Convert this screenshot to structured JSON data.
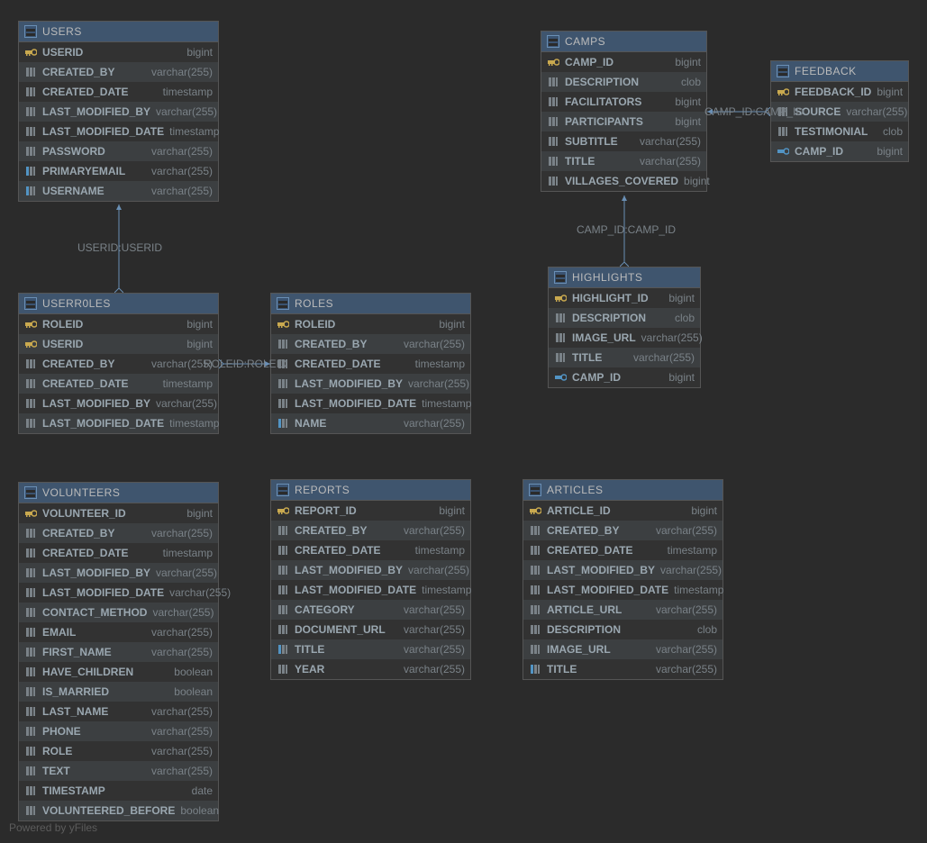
{
  "footer": "Powered by yFiles",
  "relations": {
    "users_userroles": "USERID:USERID",
    "roles_userroles": "ROLEID:ROLEID",
    "camps_highlights": "CAMP_ID:CAMP_ID",
    "camps_feedback": "CAMP_ID:CAMP_ID"
  },
  "tables": {
    "users": {
      "name": "USERS",
      "cols": [
        {
          "k": "pk",
          "n": "USERID",
          "t": "bigint"
        },
        {
          "k": "col",
          "n": "CREATED_BY",
          "t": "varchar(255)"
        },
        {
          "k": "col",
          "n": "CREATED_DATE",
          "t": "timestamp"
        },
        {
          "k": "col",
          "n": "LAST_MODIFIED_BY",
          "t": "varchar(255)"
        },
        {
          "k": "col",
          "n": "LAST_MODIFIED_DATE",
          "t": "timestamp"
        },
        {
          "k": "col",
          "n": "PASSWORD",
          "t": "varchar(255)"
        },
        {
          "k": "idx",
          "n": "PRIMARYEMAIL",
          "t": "varchar(255)"
        },
        {
          "k": "idx",
          "n": "USERNAME",
          "t": "varchar(255)"
        }
      ]
    },
    "userroles": {
      "name": "USERR0LES",
      "cols": [
        {
          "k": "pk",
          "n": "ROLEID",
          "t": "bigint"
        },
        {
          "k": "pk",
          "n": "USERID",
          "t": "bigint"
        },
        {
          "k": "col",
          "n": "CREATED_BY",
          "t": "varchar(255)"
        },
        {
          "k": "col",
          "n": "CREATED_DATE",
          "t": "timestamp"
        },
        {
          "k": "col",
          "n": "LAST_MODIFIED_BY",
          "t": "varchar(255)"
        },
        {
          "k": "col",
          "n": "LAST_MODIFIED_DATE",
          "t": "timestamp"
        }
      ]
    },
    "roles": {
      "name": "ROLES",
      "cols": [
        {
          "k": "pk",
          "n": "ROLEID",
          "t": "bigint"
        },
        {
          "k": "col",
          "n": "CREATED_BY",
          "t": "varchar(255)"
        },
        {
          "k": "col",
          "n": "CREATED_DATE",
          "t": "timestamp"
        },
        {
          "k": "col",
          "n": "LAST_MODIFIED_BY",
          "t": "varchar(255)"
        },
        {
          "k": "col",
          "n": "LAST_MODIFIED_DATE",
          "t": "timestamp"
        },
        {
          "k": "idx",
          "n": "NAME",
          "t": "varchar(255)"
        }
      ]
    },
    "camps": {
      "name": "CAMPS",
      "cols": [
        {
          "k": "pk",
          "n": "CAMP_ID",
          "t": "bigint"
        },
        {
          "k": "col",
          "n": "DESCRIPTION",
          "t": "clob"
        },
        {
          "k": "col",
          "n": "FACILITATORS",
          "t": "bigint"
        },
        {
          "k": "col",
          "n": "PARTICIPANTS",
          "t": "bigint"
        },
        {
          "k": "col",
          "n": "SUBTITLE",
          "t": "varchar(255)"
        },
        {
          "k": "col",
          "n": "TITLE",
          "t": "varchar(255)"
        },
        {
          "k": "col",
          "n": "VILLAGES_COVERED",
          "t": "bigint"
        }
      ]
    },
    "feedback": {
      "name": "FEEDBACK",
      "cols": [
        {
          "k": "pk",
          "n": "FEEDBACK_ID",
          "t": "bigint"
        },
        {
          "k": "col",
          "n": "SOURCE",
          "t": "varchar(255)"
        },
        {
          "k": "col",
          "n": "TESTIMONIAL",
          "t": "clob"
        },
        {
          "k": "fk",
          "n": "CAMP_ID",
          "t": "bigint"
        }
      ]
    },
    "highlights": {
      "name": "HIGHLIGHTS",
      "cols": [
        {
          "k": "pk",
          "n": "HIGHLIGHT_ID",
          "t": "bigint"
        },
        {
          "k": "col",
          "n": "DESCRIPTION",
          "t": "clob"
        },
        {
          "k": "col",
          "n": "IMAGE_URL",
          "t": "varchar(255)"
        },
        {
          "k": "col",
          "n": "TITLE",
          "t": "varchar(255)"
        },
        {
          "k": "fk",
          "n": "CAMP_ID",
          "t": "bigint"
        }
      ]
    },
    "volunteers": {
      "name": "VOLUNTEERS",
      "cols": [
        {
          "k": "pk",
          "n": "VOLUNTEER_ID",
          "t": "bigint"
        },
        {
          "k": "col",
          "n": "CREATED_BY",
          "t": "varchar(255)"
        },
        {
          "k": "col",
          "n": "CREATED_DATE",
          "t": "timestamp"
        },
        {
          "k": "col",
          "n": "LAST_MODIFIED_BY",
          "t": "varchar(255)"
        },
        {
          "k": "col",
          "n": "LAST_MODIFIED_DATE",
          "t": "varchar(255)"
        },
        {
          "k": "col",
          "n": "CONTACT_METHOD",
          "t": "varchar(255)"
        },
        {
          "k": "col",
          "n": "EMAIL",
          "t": "varchar(255)"
        },
        {
          "k": "col",
          "n": "FIRST_NAME",
          "t": "varchar(255)"
        },
        {
          "k": "col",
          "n": "HAVE_CHILDREN",
          "t": "boolean"
        },
        {
          "k": "col",
          "n": "IS_MARRIED",
          "t": "boolean"
        },
        {
          "k": "col",
          "n": "LAST_NAME",
          "t": "varchar(255)"
        },
        {
          "k": "col",
          "n": "PHONE",
          "t": "varchar(255)"
        },
        {
          "k": "col",
          "n": "ROLE",
          "t": "varchar(255)"
        },
        {
          "k": "col",
          "n": "TEXT",
          "t": "varchar(255)"
        },
        {
          "k": "col",
          "n": "TIMESTAMP",
          "t": "date"
        },
        {
          "k": "col",
          "n": "VOLUNTEERED_BEFORE",
          "t": "boolean"
        }
      ]
    },
    "reports": {
      "name": "REPORTS",
      "cols": [
        {
          "k": "pk",
          "n": "REPORT_ID",
          "t": "bigint"
        },
        {
          "k": "col",
          "n": "CREATED_BY",
          "t": "varchar(255)"
        },
        {
          "k": "col",
          "n": "CREATED_DATE",
          "t": "timestamp"
        },
        {
          "k": "col",
          "n": "LAST_MODIFIED_BY",
          "t": "varchar(255)"
        },
        {
          "k": "col",
          "n": "LAST_MODIFIED_DATE",
          "t": "timestamp"
        },
        {
          "k": "col",
          "n": "CATEGORY",
          "t": "varchar(255)"
        },
        {
          "k": "col",
          "n": "DOCUMENT_URL",
          "t": "varchar(255)"
        },
        {
          "k": "idx",
          "n": "TITLE",
          "t": "varchar(255)"
        },
        {
          "k": "col",
          "n": "YEAR",
          "t": "varchar(255)"
        }
      ]
    },
    "articles": {
      "name": "ARTICLES",
      "cols": [
        {
          "k": "pk",
          "n": "ARTICLE_ID",
          "t": "bigint"
        },
        {
          "k": "col",
          "n": "CREATED_BY",
          "t": "varchar(255)"
        },
        {
          "k": "col",
          "n": "CREATED_DATE",
          "t": "timestamp"
        },
        {
          "k": "col",
          "n": "LAST_MODIFIED_BY",
          "t": "varchar(255)"
        },
        {
          "k": "col",
          "n": "LAST_MODIFIED_DATE",
          "t": "timestamp"
        },
        {
          "k": "col",
          "n": "ARTICLE_URL",
          "t": "varchar(255)"
        },
        {
          "k": "col",
          "n": "DESCRIPTION",
          "t": "clob"
        },
        {
          "k": "col",
          "n": "IMAGE_URL",
          "t": "varchar(255)"
        },
        {
          "k": "idx",
          "n": "TITLE",
          "t": "varchar(255)"
        }
      ]
    }
  }
}
